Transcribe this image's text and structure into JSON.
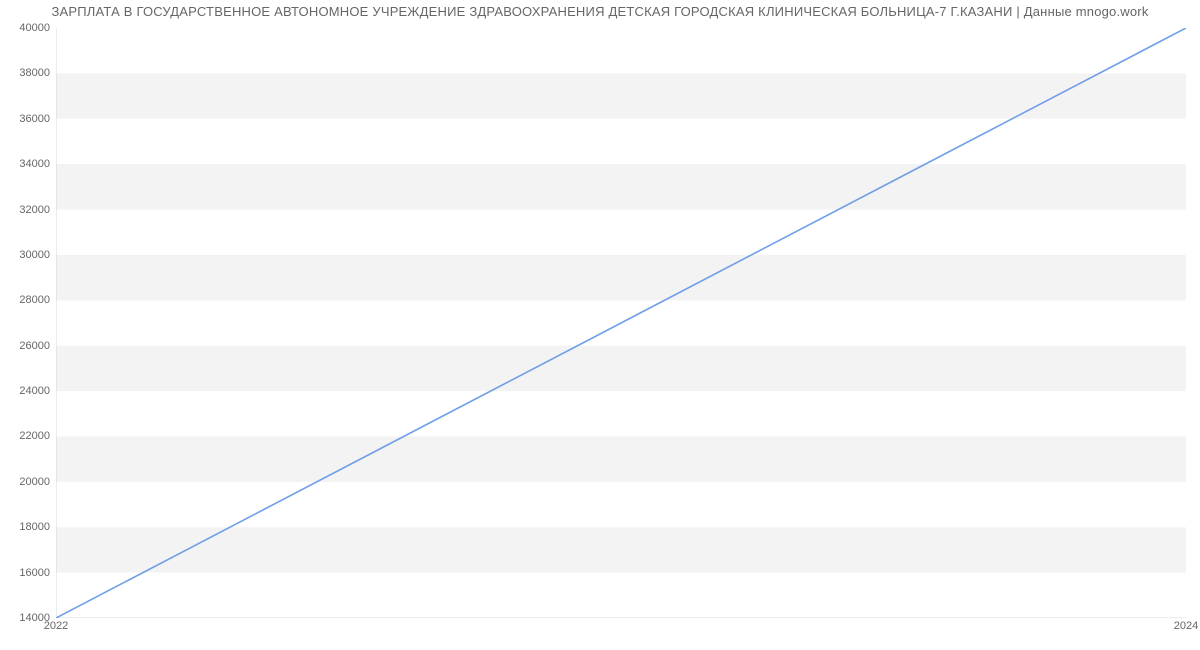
{
  "chart_data": {
    "type": "line",
    "title": "ЗАРПЛАТА В ГОСУДАРСТВЕННОЕ АВТОНОМНОЕ УЧРЕЖДЕНИЕ ЗДРАВООХРАНЕНИЯ ДЕТСКАЯ ГОРОДСКАЯ КЛИНИЧЕСКАЯ БОЛЬНИЦА-7 Г.КАЗАНИ | Данные mnogo.work",
    "x": [
      2022,
      2024
    ],
    "values": [
      14000,
      40000
    ],
    "y_ticks": [
      14000,
      16000,
      18000,
      20000,
      22000,
      24000,
      26000,
      28000,
      30000,
      32000,
      34000,
      36000,
      38000,
      40000
    ],
    "x_ticks": [
      2022,
      2024
    ],
    "xlabel": "",
    "ylabel": "",
    "ylim": [
      14000,
      40000
    ],
    "xlim": [
      2022,
      2024
    ],
    "colors": {
      "line": "#6f9ee8",
      "band": "#f3f3f3"
    }
  }
}
